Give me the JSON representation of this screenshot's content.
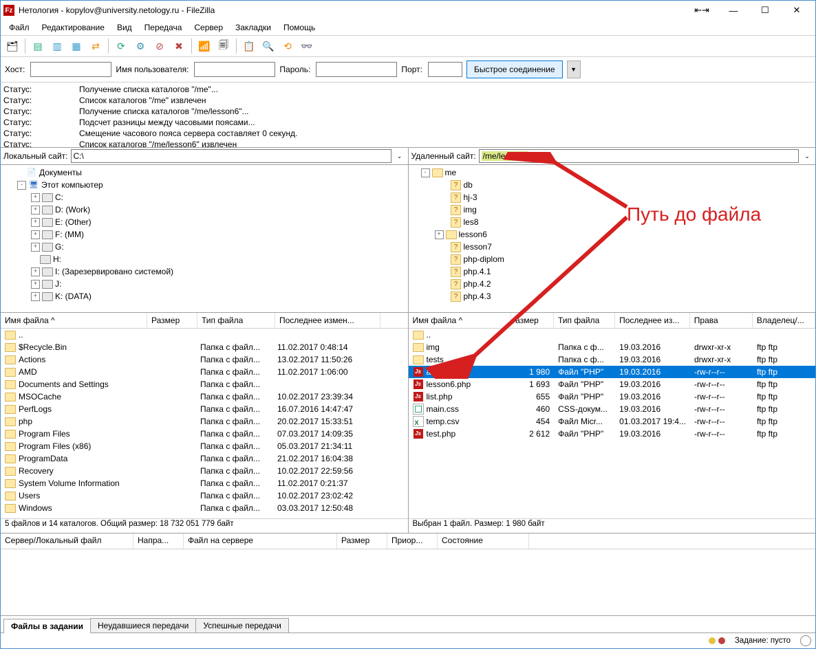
{
  "title": "Нетология - kopylov@university.netology.ru - FileZilla",
  "menu": [
    "Файл",
    "Редактирование",
    "Вид",
    "Передача",
    "Сервер",
    "Закладки",
    "Помощь"
  ],
  "qc": {
    "host": "Хост:",
    "user": "Имя пользователя:",
    "pass": "Пароль:",
    "port": "Порт:",
    "btn": "Быстрое соединение"
  },
  "log": [
    {
      "l": "Статус:",
      "t": "Получение списка каталогов \"/me\"..."
    },
    {
      "l": "Статус:",
      "t": "Список каталогов \"/me\" извлечен"
    },
    {
      "l": "Статус:",
      "t": "Получение списка каталогов \"/me/lesson6\"..."
    },
    {
      "l": "Статус:",
      "t": "Подсчет разницы между часовыми поясами..."
    },
    {
      "l": "Статус:",
      "t": "Смещение часового пояса сервера составляет 0 секунд."
    },
    {
      "l": "Статус:",
      "t": "Список каталогов \"/me/lesson6\" извлечен"
    }
  ],
  "local": {
    "label": "Локальный сайт:",
    "path": "C:\\",
    "tree": [
      {
        "ind": 24,
        "sq": "",
        "ico": "doc",
        "t": "Документы"
      },
      {
        "ind": 24,
        "sq": "-",
        "ico": "pc",
        "t": "Этот компьютер"
      },
      {
        "ind": 44,
        "sq": "+",
        "ico": "drive",
        "t": "C:"
      },
      {
        "ind": 44,
        "sq": "+",
        "ico": "drive",
        "t": "D: (Work)"
      },
      {
        "ind": 44,
        "sq": "+",
        "ico": "drive",
        "t": "E: (Other)"
      },
      {
        "ind": 44,
        "sq": "+",
        "ico": "drive",
        "t": "F: (MM)"
      },
      {
        "ind": 44,
        "sq": "+",
        "ico": "drive",
        "t": "G:"
      },
      {
        "ind": 44,
        "sq": "",
        "ico": "drive",
        "t": "H:"
      },
      {
        "ind": 44,
        "sq": "+",
        "ico": "drive",
        "t": "I: (Зарезервировано системой)"
      },
      {
        "ind": 44,
        "sq": "+",
        "ico": "drive",
        "t": "J:"
      },
      {
        "ind": 44,
        "sq": "+",
        "ico": "drive",
        "t": "K: (DATA)"
      }
    ],
    "hdr": {
      "name": "Имя файла",
      "size": "Размер",
      "type": "Тип файла",
      "mod": "Последнее измен..."
    },
    "cols": {
      "name": 200,
      "size": 60,
      "type": 100,
      "mod": 140
    },
    "files": [
      {
        "n": "..",
        "ico": "fold",
        "s": "",
        "t": "",
        "m": ""
      },
      {
        "n": "$Recycle.Bin",
        "ico": "fold",
        "s": "",
        "t": "Папка с файл...",
        "m": "11.02.2017 0:48:14"
      },
      {
        "n": "Actions",
        "ico": "fold",
        "s": "",
        "t": "Папка с файл...",
        "m": "13.02.2017 11:50:26"
      },
      {
        "n": "AMD",
        "ico": "fold",
        "s": "",
        "t": "Папка с файл...",
        "m": "11.02.2017 1:06:00"
      },
      {
        "n": "Documents and Settings",
        "ico": "fold",
        "s": "",
        "t": "Папка с файл...",
        "m": ""
      },
      {
        "n": "MSOCache",
        "ico": "fold",
        "s": "",
        "t": "Папка с файл...",
        "m": "10.02.2017 23:39:34"
      },
      {
        "n": "PerfLogs",
        "ico": "fold",
        "s": "",
        "t": "Папка с файл...",
        "m": "16.07.2016 14:47:47"
      },
      {
        "n": "php",
        "ico": "fold",
        "s": "",
        "t": "Папка с файл...",
        "m": "20.02.2017 15:33:51"
      },
      {
        "n": "Program Files",
        "ico": "fold",
        "s": "",
        "t": "Папка с файл...",
        "m": "07.03.2017 14:09:35"
      },
      {
        "n": "Program Files (x86)",
        "ico": "fold",
        "s": "",
        "t": "Папка с файл...",
        "m": "05.03.2017 21:34:11"
      },
      {
        "n": "ProgramData",
        "ico": "fold",
        "s": "",
        "t": "Папка с файл...",
        "m": "21.02.2017 16:04:38"
      },
      {
        "n": "Recovery",
        "ico": "fold",
        "s": "",
        "t": "Папка с файл...",
        "m": "10.02.2017 22:59:56"
      },
      {
        "n": "System Volume Information",
        "ico": "fold",
        "s": "",
        "t": "Папка с файл...",
        "m": "11.02.2017 0:21:37"
      },
      {
        "n": "Users",
        "ico": "fold",
        "s": "",
        "t": "Папка с файл...",
        "m": "10.02.2017 23:02:42"
      },
      {
        "n": "Windows",
        "ico": "fold",
        "s": "",
        "t": "Папка с файл...",
        "m": "03.03.2017 12:50:48"
      }
    ],
    "status": "5 файлов и 14 каталогов. Общий размер: 18 732 051 779 байт"
  },
  "remote": {
    "label": "Удаленный сайт:",
    "path": "/me/lesson6",
    "tree": [
      {
        "ind": 18,
        "sq": "-",
        "ico": "fold",
        "t": "me"
      },
      {
        "ind": 48,
        "sq": "",
        "ico": "q",
        "t": "db"
      },
      {
        "ind": 48,
        "sq": "",
        "ico": "q",
        "t": "hj-3"
      },
      {
        "ind": 48,
        "sq": "",
        "ico": "q",
        "t": "img"
      },
      {
        "ind": 48,
        "sq": "",
        "ico": "q",
        "t": "les8"
      },
      {
        "ind": 38,
        "sq": "+",
        "ico": "fold",
        "t": "lesson6"
      },
      {
        "ind": 48,
        "sq": "",
        "ico": "q",
        "t": "lesson7"
      },
      {
        "ind": 48,
        "sq": "",
        "ico": "q",
        "t": "php-diplom"
      },
      {
        "ind": 48,
        "sq": "",
        "ico": "q",
        "t": "php.4.1"
      },
      {
        "ind": 48,
        "sq": "",
        "ico": "q",
        "t": "php.4.2"
      },
      {
        "ind": 48,
        "sq": "",
        "ico": "q",
        "t": "php.4.3"
      }
    ],
    "hdr": {
      "name": "Имя файла",
      "size": "азмер",
      "type": "Тип файла",
      "mod": "Последнее из...",
      "perm": "Права",
      "own": "Владелец/..."
    },
    "cols": {
      "name": 140,
      "size": 50,
      "type": 78,
      "mod": 98,
      "perm": 80,
      "own": 80
    },
    "files": [
      {
        "n": "..",
        "ico": "fold",
        "s": "",
        "t": "",
        "m": "",
        "p": "",
        "o": ""
      },
      {
        "n": "img",
        "ico": "fold",
        "s": "",
        "t": "Папка с ф...",
        "m": "19.03.2016",
        "p": "drwxr-xr-x",
        "o": "ftp ftp"
      },
      {
        "n": "tests",
        "ico": "fold",
        "s": "",
        "t": "Папка с ф...",
        "m": "19.03.2016",
        "p": "drwxr-xr-x",
        "o": "ftp ftp"
      },
      {
        "n": "admin.php",
        "ico": "php",
        "s": "1 980",
        "t": "Файл \"PHP\"",
        "m": "19.03.2016",
        "p": "-rw-r--r--",
        "o": "ftp ftp",
        "sel": true
      },
      {
        "n": "lesson6.php",
        "ico": "php",
        "s": "1 693",
        "t": "Файл \"PHP\"",
        "m": "19.03.2016",
        "p": "-rw-r--r--",
        "o": "ftp ftp"
      },
      {
        "n": "list.php",
        "ico": "php",
        "s": "655",
        "t": "Файл \"PHP\"",
        "m": "19.03.2016",
        "p": "-rw-r--r--",
        "o": "ftp ftp"
      },
      {
        "n": "main.css",
        "ico": "css",
        "s": "460",
        "t": "CSS-докум...",
        "m": "19.03.2016",
        "p": "-rw-r--r--",
        "o": "ftp ftp"
      },
      {
        "n": "temp.csv",
        "ico": "xls",
        "s": "454",
        "t": "Файл Micr...",
        "m": "01.03.2017 19:4...",
        "p": "-rw-r--r--",
        "o": "ftp ftp"
      },
      {
        "n": "test.php",
        "ico": "php",
        "s": "2 612",
        "t": "Файл \"PHP\"",
        "m": "19.03.2016",
        "p": "-rw-r--r--",
        "o": "ftp ftp"
      }
    ],
    "status": "Выбран 1 файл. Размер: 1 980 байт"
  },
  "queue": {
    "hdr": [
      "Сервер/Локальный файл",
      "Напра...",
      "Файл на сервере",
      "Размер",
      "Приор...",
      "Состояние"
    ],
    "cols": [
      180,
      60,
      210,
      60,
      60,
      120
    ]
  },
  "tabs": [
    "Файлы в задании",
    "Неудавшиеся передачи",
    "Успешные передачи"
  ],
  "statusbar": {
    "queue": "Задание: пусто"
  },
  "annotation": "Путь до файла"
}
